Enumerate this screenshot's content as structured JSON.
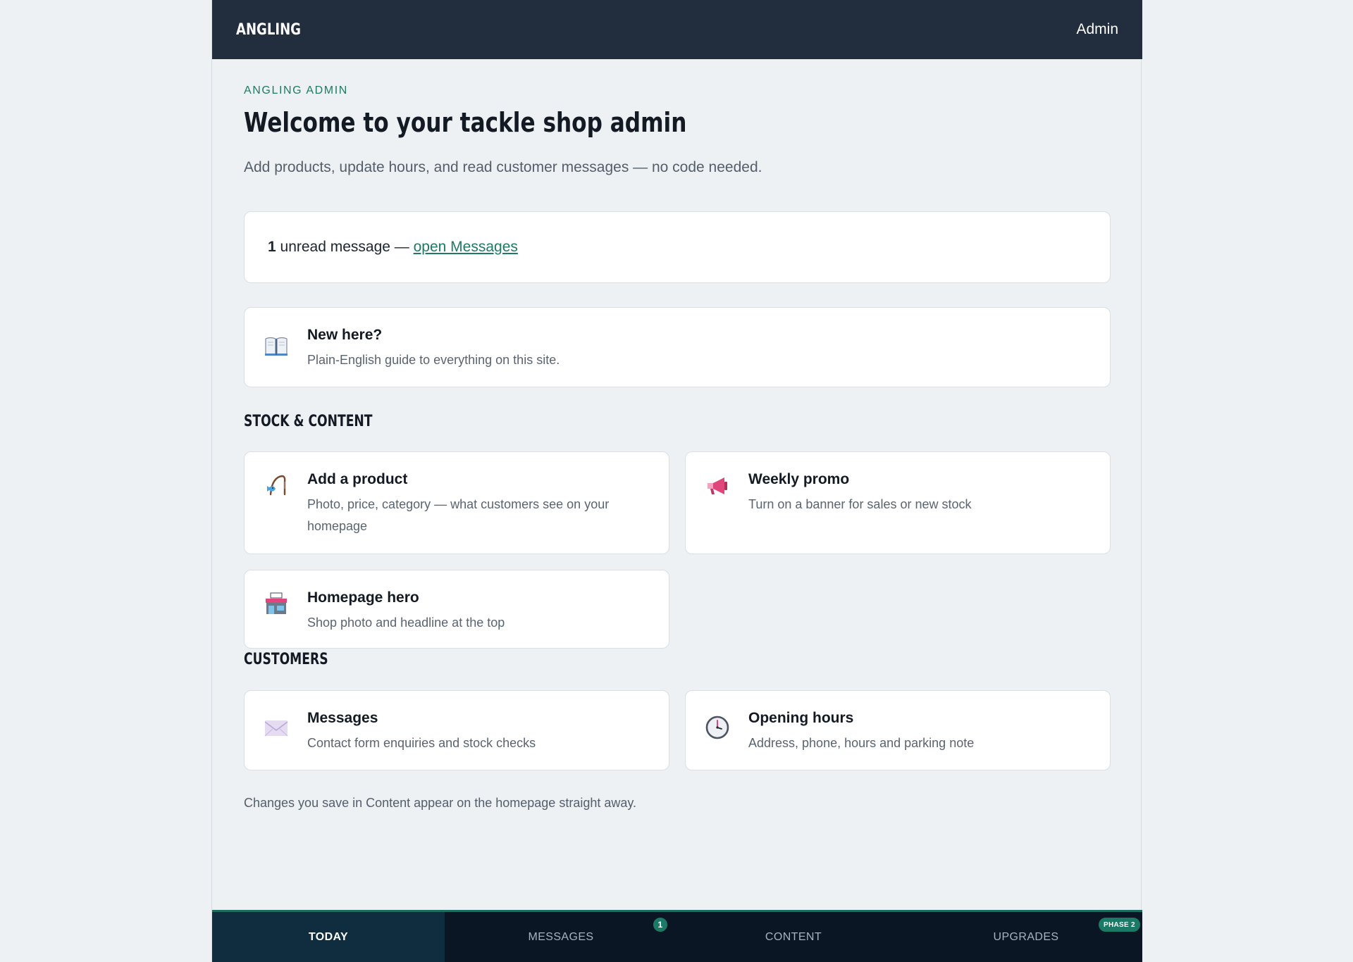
{
  "header": {
    "brand": "ANGLING",
    "admin_label": "Admin"
  },
  "intro": {
    "eyebrow": "ANGLING ADMIN",
    "title": "Welcome to your tackle shop admin",
    "subtitle": "Add products, update hours, and read customer messages — no code needed."
  },
  "unread": {
    "count": "1",
    "text": " unread message — ",
    "link": "open Messages"
  },
  "guide": {
    "title": "New here?",
    "desc": "Plain-English guide to everything on this site.",
    "icon": "open-book-icon"
  },
  "stock_section": {
    "heading": "STOCK & CONTENT",
    "tiles": [
      {
        "title": "Add a product",
        "desc": "Photo, price, category — what customers see on your homepage",
        "icon": "fishing-rod-icon"
      },
      {
        "title": "Weekly promo",
        "desc": "Turn on a banner for sales or new stock",
        "icon": "megaphone-icon"
      },
      {
        "title": "Homepage hero",
        "desc": "Shop photo and headline at the top",
        "icon": "storefront-icon"
      }
    ]
  },
  "customers_section": {
    "heading": "CUSTOMERS",
    "tiles": [
      {
        "title": "Messages",
        "desc": "Contact form enquiries and stock checks",
        "icon": "envelope-icon"
      },
      {
        "title": "Opening hours",
        "desc": "Address, phone, hours and parking note",
        "icon": "clock-icon"
      }
    ]
  },
  "footnote": "Changes you save in Content appear on the homepage straight away.",
  "bottom_nav": {
    "tabs": [
      {
        "label": "TODAY",
        "active": true
      },
      {
        "label": "MESSAGES",
        "badge": "1"
      },
      {
        "label": "CONTENT"
      },
      {
        "label": "UPGRADES",
        "badge": "PHASE 2"
      }
    ]
  },
  "colors": {
    "accent": "#1e7a63",
    "topbar": "#222d3d",
    "nav": "#0b1624",
    "nav_active": "#0f2d3e",
    "page_bg": "#edf1f4"
  }
}
